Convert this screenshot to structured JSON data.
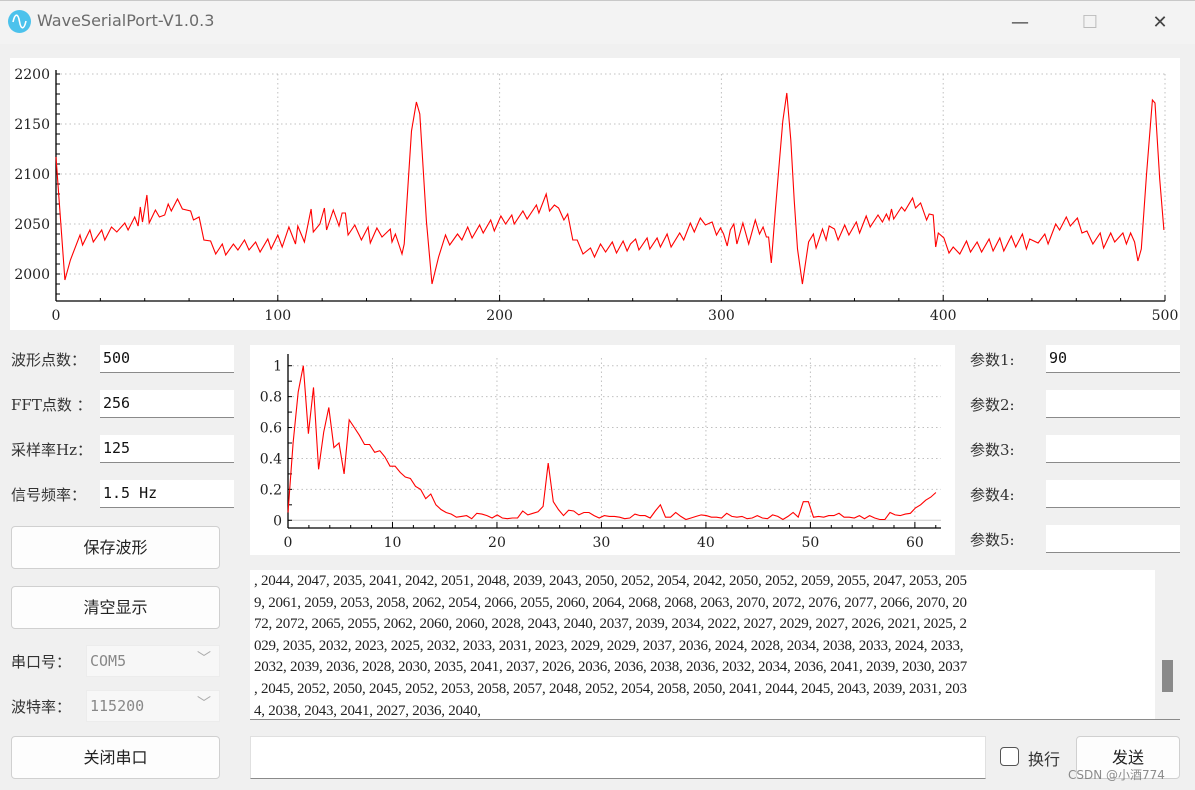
{
  "window": {
    "title": "WaveSerialPort-V1.0.3",
    "icon": "sine-wave-icon",
    "minimize": "—",
    "maximize": "☐",
    "close": "✕"
  },
  "left": {
    "wave_points_label": "波形点数：",
    "wave_points_value": "500",
    "fft_points_label": "FFT点数 ：",
    "fft_points_value": "256",
    "sample_rate_label": "采样率Hz：",
    "sample_rate_value": "125",
    "signal_freq_label": "信号频率：",
    "signal_freq_value": "1.5 Hz",
    "save_button": "保存波形",
    "clear_button": "清空显示",
    "port_label": "串口号：",
    "port_value": "COM5",
    "baud_label": "波特率：",
    "baud_value": "115200",
    "close_port_button": "关闭串口"
  },
  "right": {
    "params": [
      {
        "label": "参数1:",
        "value": "90"
      },
      {
        "label": "参数2:",
        "value": ""
      },
      {
        "label": "参数3:",
        "value": ""
      },
      {
        "label": "参数4:",
        "value": ""
      },
      {
        "label": "参数5:",
        "value": ""
      }
    ]
  },
  "receive_text": [
    ", 2044, 2047, 2035, 2041, 2042, 2051, 2048, 2039, 2043, 2050, 2052, 2054, 2042, 2050, 2052, 2059, 2055, 2047, 2053, 205",
    "9, 2061, 2059, 2053, 2058, 2062, 2054, 2066, 2055, 2060, 2064, 2068, 2068, 2063, 2070, 2072, 2076, 2077, 2066, 2070, 20",
    "72, 2072, 2065, 2055, 2062, 2060, 2060, 2028, 2043, 2040, 2037, 2039, 2034, 2022, 2027, 2029, 2027, 2026, 2021, 2025, 2",
    "029, 2035, 2032, 2023, 2025, 2032, 2033, 2031, 2023, 2029, 2029, 2037, 2036, 2024, 2028, 2034, 2038, 2033, 2024, 2033,",
    "2032, 2039, 2036, 2028, 2030, 2035, 2041, 2037, 2026, 2036, 2036, 2038, 2036, 2032, 2034, 2036, 2041, 2039, 2030, 2037",
    ", 2045, 2052, 2050, 2045, 2052, 2053, 2058, 2057, 2048, 2052, 2054, 2058, 2050, 2041, 2044, 2045, 2043, 2039, 2031, 203",
    "4, 2038, 2043, 2041, 2027, 2036, 2040,"
  ],
  "bottom": {
    "send_input": "",
    "newline_label": "换行",
    "newline_checked": false,
    "send_button": "发送"
  },
  "watermark": "CSDN @小酒774",
  "colors": {
    "line": "#ff0000",
    "grid": "#c0c0c0",
    "icon": "#4cc2ec"
  },
  "chart_data": [
    {
      "type": "line",
      "xlim": [
        0,
        500
      ],
      "ylim": [
        1973,
        2200
      ],
      "xticks": [
        0,
        100,
        200,
        300,
        400,
        500
      ],
      "yticks": [
        2000,
        2050,
        2100,
        2150,
        2200
      ],
      "grid": true,
      "points": [
        [
          0,
          2117
        ],
        [
          4,
          1994
        ],
        [
          6.5,
          2014
        ],
        [
          10.8,
          2039
        ],
        [
          12,
          2029
        ],
        [
          15.3,
          2044
        ],
        [
          16.8,
          2032
        ],
        [
          20.6,
          2044
        ],
        [
          22,
          2034
        ],
        [
          25,
          2047
        ],
        [
          27.4,
          2042
        ],
        [
          31,
          2051
        ],
        [
          32.5,
          2044
        ],
        [
          35.5,
          2057
        ],
        [
          37,
          2048
        ],
        [
          38,
          2067
        ],
        [
          39,
          2052
        ],
        [
          41,
          2079
        ],
        [
          42,
          2051
        ],
        [
          44.8,
          2064
        ],
        [
          46.6,
          2057
        ],
        [
          49,
          2059
        ],
        [
          50.6,
          2070
        ],
        [
          52,
          2063
        ],
        [
          54.8,
          2075
        ],
        [
          57,
          2065
        ],
        [
          60.7,
          2063
        ],
        [
          62,
          2054
        ],
        [
          64.5,
          2057
        ],
        [
          66.7,
          2034
        ],
        [
          69.7,
          2033
        ],
        [
          72,
          2020
        ],
        [
          75,
          2030
        ],
        [
          76.5,
          2019
        ],
        [
          80,
          2030
        ],
        [
          82,
          2024
        ],
        [
          85,
          2034
        ],
        [
          87,
          2024
        ],
        [
          90,
          2032
        ],
        [
          92,
          2022
        ],
        [
          95.5,
          2035
        ],
        [
          97,
          2025
        ],
        [
          100,
          2039
        ],
        [
          102,
          2027
        ],
        [
          105,
          2047
        ],
        [
          108,
          2030
        ],
        [
          109,
          2048
        ],
        [
          112,
          2032
        ],
        [
          115,
          2065
        ],
        [
          116,
          2042
        ],
        [
          119,
          2050
        ],
        [
          121,
          2066
        ],
        [
          122,
          2044
        ],
        [
          125,
          2064
        ],
        [
          127.6,
          2048
        ],
        [
          129,
          2061
        ],
        [
          130.5,
          2061
        ],
        [
          131.7,
          2039
        ],
        [
          134.7,
          2049
        ],
        [
          137.7,
          2034
        ],
        [
          140.7,
          2047
        ],
        [
          141.7,
          2031
        ],
        [
          144.7,
          2046
        ],
        [
          147,
          2037
        ],
        [
          150.7,
          2045
        ],
        [
          151.5,
          2032
        ],
        [
          153,
          2040
        ],
        [
          156,
          2020
        ],
        [
          157,
          2030
        ],
        [
          160.3,
          2143
        ],
        [
          162.5,
          2172
        ],
        [
          164,
          2160
        ],
        [
          167,
          2053
        ],
        [
          169.5,
          1990
        ],
        [
          172.5,
          2017
        ],
        [
          175.6,
          2039
        ],
        [
          177.5,
          2029
        ],
        [
          181,
          2040
        ],
        [
          183,
          2034
        ],
        [
          185.6,
          2047
        ],
        [
          187.6,
          2036
        ],
        [
          191,
          2049
        ],
        [
          192.6,
          2041
        ],
        [
          196,
          2054
        ],
        [
          197.6,
          2043
        ],
        [
          200.6,
          2058
        ],
        [
          202.7,
          2050
        ],
        [
          205.5,
          2059
        ],
        [
          206.6,
          2050
        ],
        [
          210.5,
          2063
        ],
        [
          212.4,
          2055
        ],
        [
          216.6,
          2069
        ],
        [
          217.7,
          2061
        ],
        [
          221,
          2080
        ],
        [
          222.5,
          2063
        ],
        [
          224.7,
          2069
        ],
        [
          226.6,
          2066
        ],
        [
          229,
          2054
        ],
        [
          230.7,
          2060
        ],
        [
          233,
          2034
        ],
        [
          235,
          2034
        ],
        [
          237.6,
          2020
        ],
        [
          241,
          2026
        ],
        [
          242.8,
          2017
        ],
        [
          245.5,
          2030
        ],
        [
          247.8,
          2022
        ],
        [
          250.8,
          2032
        ],
        [
          252.7,
          2021
        ],
        [
          255.7,
          2033
        ],
        [
          257.5,
          2023
        ],
        [
          259,
          2030
        ],
        [
          261.3,
          2035
        ],
        [
          262.8,
          2024
        ],
        [
          266.5,
          2036
        ],
        [
          267.7,
          2025
        ],
        [
          271,
          2036
        ],
        [
          272.5,
          2027
        ],
        [
          275.5,
          2040
        ],
        [
          277.3,
          2027
        ],
        [
          281.2,
          2041
        ],
        [
          283,
          2034
        ],
        [
          286,
          2051
        ],
        [
          287.8,
          2042
        ],
        [
          290.5,
          2056
        ],
        [
          292.8,
          2049
        ],
        [
          295.8,
          2052
        ],
        [
          297.8,
          2039
        ],
        [
          299.6,
          2046
        ],
        [
          301,
          2040
        ],
        [
          302.6,
          2028
        ],
        [
          304,
          2044
        ],
        [
          305.6,
          2050
        ],
        [
          307,
          2030
        ],
        [
          309.7,
          2051
        ],
        [
          312.3,
          2030
        ],
        [
          315.3,
          2054
        ],
        [
          317.2,
          2040
        ],
        [
          318.8,
          2047
        ],
        [
          320.3,
          2037
        ],
        [
          321.3,
          2037
        ],
        [
          322.5,
          2011
        ],
        [
          324.3,
          2063
        ],
        [
          325.8,
          2103
        ],
        [
          327.7,
          2153
        ],
        [
          329.5,
          2181
        ],
        [
          331.3,
          2134
        ],
        [
          332.8,
          2074
        ],
        [
          334.3,
          2025
        ],
        [
          336.5,
          1990
        ],
        [
          339.3,
          2032
        ],
        [
          341.5,
          2040
        ],
        [
          342.7,
          2026
        ],
        [
          345.6,
          2045
        ],
        [
          347.2,
          2034
        ],
        [
          348.6,
          2048
        ],
        [
          351,
          2045
        ],
        [
          352.6,
          2034
        ],
        [
          355.6,
          2049
        ],
        [
          357.5,
          2039
        ],
        [
          360.8,
          2052
        ],
        [
          362.3,
          2041
        ],
        [
          365.3,
          2058
        ],
        [
          367.1,
          2047
        ],
        [
          370.6,
          2059
        ],
        [
          372.6,
          2052
        ],
        [
          374.4,
          2060
        ],
        [
          375.6,
          2054
        ],
        [
          376.7,
          2065
        ],
        [
          377.7,
          2055
        ],
        [
          381.2,
          2067
        ],
        [
          382.7,
          2063
        ],
        [
          386.2,
          2076
        ],
        [
          387.5,
          2066
        ],
        [
          389.8,
          2071
        ],
        [
          392.5,
          2054
        ],
        [
          393.7,
          2060
        ],
        [
          395.5,
          2059
        ],
        [
          396.6,
          2027
        ],
        [
          397.8,
          2041
        ],
        [
          400.3,
          2036
        ],
        [
          402.6,
          2021
        ],
        [
          404.5,
          2027
        ],
        [
          407.5,
          2020
        ],
        [
          410.5,
          2033
        ],
        [
          412.3,
          2022
        ],
        [
          415.3,
          2032
        ],
        [
          417.3,
          2022
        ],
        [
          420.7,
          2035
        ],
        [
          422.5,
          2023
        ],
        [
          425.5,
          2036
        ],
        [
          427.3,
          2023
        ],
        [
          430.7,
          2038
        ],
        [
          432.7,
          2027
        ],
        [
          435.7,
          2040
        ],
        [
          437.5,
          2025
        ],
        [
          439,
          2035
        ],
        [
          442.8,
          2031
        ],
        [
          445.8,
          2040
        ],
        [
          447.3,
          2030
        ],
        [
          450.7,
          2050
        ],
        [
          452.5,
          2044
        ],
        [
          455.5,
          2057
        ],
        [
          457.3,
          2048
        ],
        [
          460.5,
          2056
        ],
        [
          462.6,
          2041
        ],
        [
          464.8,
          2043
        ],
        [
          467.5,
          2030
        ],
        [
          470.8,
          2041
        ],
        [
          472.3,
          2026
        ],
        [
          475.5,
          2041
        ],
        [
          477.3,
          2032
        ],
        [
          481,
          2041
        ],
        [
          482.6,
          2030
        ],
        [
          484.5,
          2041
        ],
        [
          486.3,
          2032
        ],
        [
          487.8,
          2013
        ],
        [
          489.3,
          2025
        ],
        [
          491.6,
          2098
        ],
        [
          494.3,
          2174
        ],
        [
          495.5,
          2171
        ],
        [
          497.6,
          2095
        ],
        [
          499.5,
          2044
        ]
      ]
    },
    {
      "type": "line",
      "xlim": [
        0,
        62.5
      ],
      "ylim": [
        -0.05,
        1.05
      ],
      "xticks": [
        0,
        10,
        20,
        30,
        40,
        50,
        60
      ],
      "yticks": [
        0,
        0.2,
        0.4,
        0.6,
        0.8,
        1
      ],
      "grid": true,
      "x_step": 0.48828125,
      "values": [
        0.05,
        0.5,
        0.83,
        1.0,
        0.56,
        0.86,
        0.33,
        0.57,
        0.73,
        0.47,
        0.5,
        0.3,
        0.65,
        0.6,
        0.55,
        0.49,
        0.49,
        0.44,
        0.45,
        0.41,
        0.35,
        0.35,
        0.31,
        0.28,
        0.27,
        0.22,
        0.2,
        0.14,
        0.17,
        0.1,
        0.07,
        0.05,
        0.04,
        0.02,
        0.025,
        0.03,
        0.01,
        0.045,
        0.04,
        0.03,
        0.015,
        0.035,
        0.015,
        0.01,
        0.015,
        0.015,
        0.06,
        0.035,
        0.045,
        0.055,
        0.09,
        0.37,
        0.12,
        0.07,
        0.03,
        0.065,
        0.06,
        0.035,
        0.05,
        0.05,
        0.03,
        0.015,
        0.03,
        0.025,
        0.025,
        0.02,
        0.01,
        0.015,
        0.04,
        0.03,
        0.03,
        0.015,
        0.06,
        0.1,
        0.02,
        0.02,
        0.05,
        0.025,
        0.005,
        0.015,
        0.025,
        0.035,
        0.03,
        0.02,
        0.02,
        0.015,
        0.045,
        0.025,
        0.02,
        0.025,
        0.01,
        0.015,
        0.03,
        0.015,
        0.01,
        0.035,
        0.025,
        0.005,
        0.025,
        0.05,
        0.02,
        0.12,
        0.12,
        0.02,
        0.025,
        0.02,
        0.03,
        0.03,
        0.045,
        0.02,
        0.02,
        0.015,
        0.03,
        0.01,
        0.03,
        0.015,
        0.005,
        0.005,
        0.05,
        0.035,
        0.03,
        0.04,
        0.045,
        0.08,
        0.1,
        0.13,
        0.15,
        0.18
      ]
    }
  ]
}
